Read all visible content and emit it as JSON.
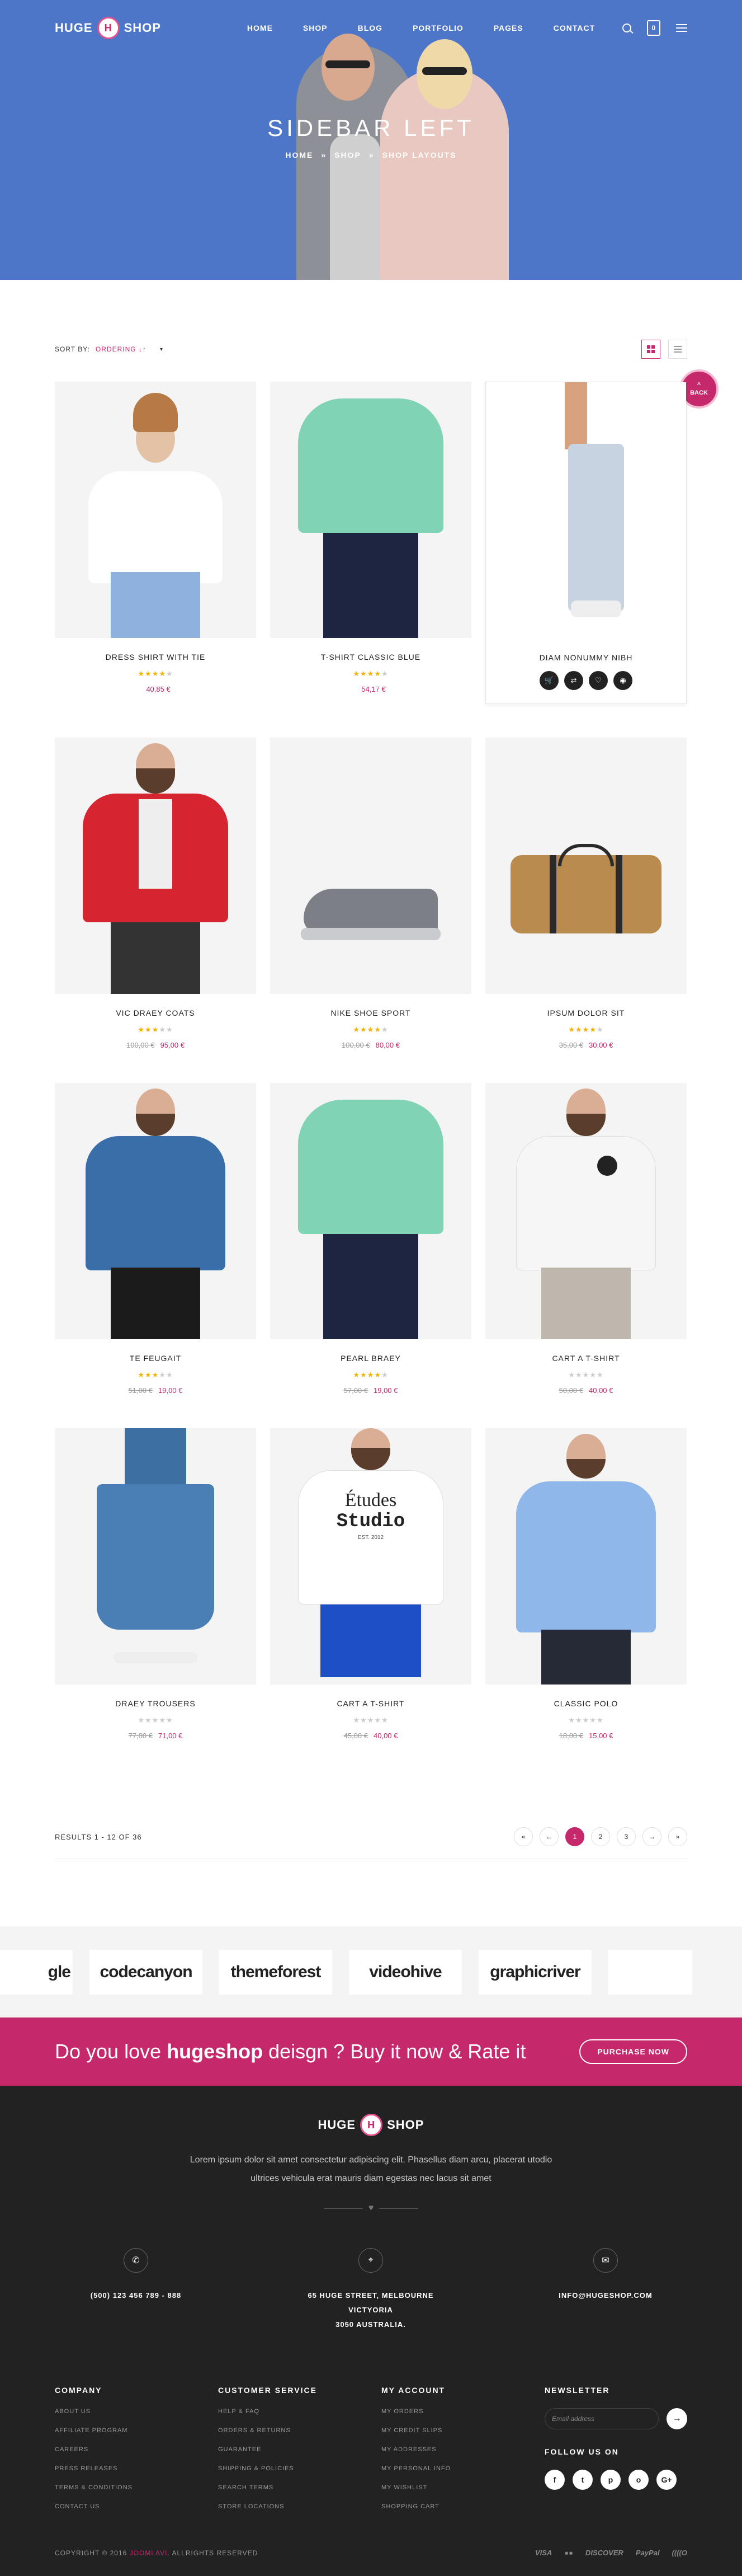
{
  "header": {
    "logo_left": "HUGE",
    "logo_mark": "H",
    "logo_right": "SHOP",
    "nav": [
      "HOME",
      "SHOP",
      "BLOG",
      "PORTFOLIO",
      "PAGES",
      "CONTACT"
    ],
    "cart_count": "0"
  },
  "hero": {
    "title": "SIDEBAR LEFT",
    "breadcrumb": [
      "HOME",
      "»",
      "SHOP",
      "»",
      "SHOP LAYOUTS"
    ]
  },
  "sort": {
    "label": "SORT BY:",
    "value": "ORDERING ↓↑",
    "arrow": "▾"
  },
  "back_label": "BACK",
  "back_arrow": "^",
  "products": [
    {
      "name": "DRESS SHIRT WITH TIE",
      "stars": 4,
      "old_price": "",
      "price": "40,85 €"
    },
    {
      "name": "T-SHIRT CLASSIC BLUE",
      "stars": 4,
      "old_price": "",
      "price": "54,17 €"
    },
    {
      "name": "DIAM NONUMMY NIBH",
      "stars": 0,
      "old_price": "",
      "price": ""
    },
    {
      "name": "VIC DRAEY COATS",
      "stars": 3,
      "old_price": "100,00 €",
      "price": "95,00 €"
    },
    {
      "name": "NIKE SHOE SPORT",
      "stars": 4,
      "old_price": "100,00 €",
      "price": "80,00 €"
    },
    {
      "name": "IPSUM DOLOR SIT",
      "stars": 4,
      "old_price": "35,00 €",
      "price": "30,00 €"
    },
    {
      "name": "TE FEUGAIT",
      "stars": 3,
      "old_price": "51,00 €",
      "price": "19,00 €"
    },
    {
      "name": "PEARL BRAEY",
      "stars": 4,
      "old_price": "57,00 €",
      "price": "19,00 €"
    },
    {
      "name": "CART A T-SHIRT",
      "stars": 0,
      "old_price": "50,00 €",
      "price": "40,00 €"
    },
    {
      "name": "DRAEY TROUSERS",
      "stars": 0,
      "old_price": "77,00 €",
      "price": "71,00 €"
    },
    {
      "name": "CART A T-SHIRT",
      "stars": 0,
      "old_price": "45,00 €",
      "price": "40,00 €"
    },
    {
      "name": "CLASSIC POLO",
      "stars": 0,
      "old_price": "18,00 €",
      "price": "15,00 €"
    }
  ],
  "tshirt_print": {
    "line1": "Études",
    "line2": "Studio",
    "line3": "EST. 2012"
  },
  "pagination": {
    "results": "RESULTS 1 - 12 OF 36",
    "first": "«",
    "prev": "←",
    "pages": [
      "1",
      "2",
      "3"
    ],
    "next": "→",
    "last": "»"
  },
  "brands": [
    "gle",
    "codecanyon",
    "themeforest",
    "videohive",
    "graphicriver"
  ],
  "promo": {
    "text_before": "Do you love ",
    "text_bold": "hugeshop",
    "text_after": " deisgn ? Buy it now & Rate it",
    "button": "PURCHASE NOW"
  },
  "footer": {
    "description_1": "Lorem ipsum dolor sit amet consectetur adipiscing elit. Phasellus diam arcu, placerat utodio",
    "description_2": "ultrices vehicula erat mauris diam egestas nec lacus sit amet",
    "phone": "(500) 123 456 789 - 888",
    "address_1": "65 HUGE STREET, MELBOURNE VICTYORIA",
    "address_2": "3050 AUSTRALIA.",
    "email": "INFO@HUGESHOP.COM",
    "columns": [
      {
        "title": "COMPANY",
        "links": [
          "ABOUT US",
          "AFFILIATE PROGRAM",
          "CAREERS",
          "PRESS RELEASES",
          "TERMS & CONDITIONS",
          "CONTACT US"
        ]
      },
      {
        "title": "CUSTOMER SERVICE",
        "links": [
          "HELP & FAQ",
          "ORDERS & RETURNS",
          "GUARANTEE",
          "SHIPPING & POLICIES",
          "SEARCH TERMS",
          "STORE LOCATIONS"
        ]
      },
      {
        "title": "MY ACCOUNT",
        "links": [
          "MY ORDERS",
          "MY CREDIT SLIPS",
          "MY ADDRESSES",
          "MY PERSONAL INFO",
          "MY WISHLIST",
          "SHOPPING CART"
        ]
      }
    ],
    "newsletter_title": "NEWSLETTER",
    "newsletter_placeholder": "Email address",
    "newsletter_go": "→",
    "follow_title": "FOLLOW US ON",
    "socials": [
      "f",
      "t",
      "p",
      "o",
      "G+"
    ],
    "copyright_before": "COPYRIGHT © 2016 ",
    "copyright_brand": "JOOMLAVI",
    "copyright_after": ". ALLRIGHTS RESERVED",
    "payments": [
      "VISA",
      "●●",
      "DISCOVER",
      "PayPal",
      "((((O"
    ]
  },
  "colors": {
    "accent": "#c5286b",
    "hero": "#4d76c8",
    "footer": "#222222",
    "star": "#f5b301"
  }
}
